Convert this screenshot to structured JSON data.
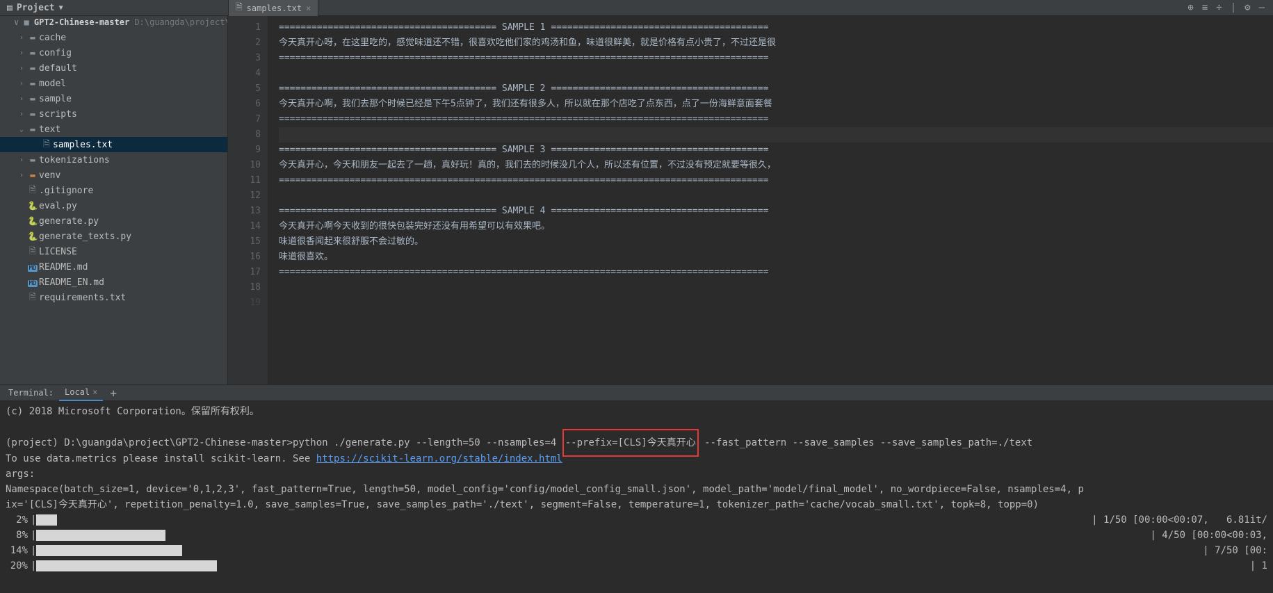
{
  "header": {
    "project_label": "Project",
    "open_file_tab": "samples.txt",
    "toolbar_icons": [
      "target-icon",
      "vertical-bars-icon",
      "horizontal-bars-icon",
      "gear-icon",
      "minimize-icon"
    ]
  },
  "breadcrumb": {
    "project_name": "GPT2-Chinese-master",
    "path_hint": "D:\\guangda\\project\\G"
  },
  "tree": [
    {
      "depth": 1,
      "arrow": ">",
      "icon": "folder",
      "label": "cache"
    },
    {
      "depth": 1,
      "arrow": ">",
      "icon": "folder",
      "label": "config"
    },
    {
      "depth": 1,
      "arrow": ">",
      "icon": "folder",
      "label": "default"
    },
    {
      "depth": 1,
      "arrow": ">",
      "icon": "folder",
      "label": "model"
    },
    {
      "depth": 1,
      "arrow": ">",
      "icon": "folder",
      "label": "sample"
    },
    {
      "depth": 1,
      "arrow": ">",
      "icon": "folder",
      "label": "scripts"
    },
    {
      "depth": 1,
      "arrow": "v",
      "icon": "folder",
      "label": "text"
    },
    {
      "depth": 2,
      "arrow": "",
      "icon": "txt",
      "label": "samples.txt",
      "selected": true
    },
    {
      "depth": 1,
      "arrow": ">",
      "icon": "folder",
      "label": "tokenizations"
    },
    {
      "depth": 1,
      "arrow": ">",
      "icon": "folder-orange",
      "label": "venv"
    },
    {
      "depth": 1,
      "arrow": "",
      "icon": "txt",
      "label": ".gitignore"
    },
    {
      "depth": 1,
      "arrow": "",
      "icon": "py",
      "label": "eval.py"
    },
    {
      "depth": 1,
      "arrow": "",
      "icon": "py",
      "label": "generate.py"
    },
    {
      "depth": 1,
      "arrow": "",
      "icon": "py",
      "label": "generate_texts.py"
    },
    {
      "depth": 1,
      "arrow": "",
      "icon": "txt",
      "label": "LICENSE"
    },
    {
      "depth": 1,
      "arrow": "",
      "icon": "md",
      "label": "README.md"
    },
    {
      "depth": 1,
      "arrow": "",
      "icon": "md",
      "label": "README_EN.md"
    },
    {
      "depth": 1,
      "arrow": "",
      "icon": "txt",
      "label": "requirements.txt"
    }
  ],
  "editor": {
    "lines": [
      "======================================== SAMPLE 1 ========================================",
      "今天真开心呀，在这里吃的，感觉味道还不错，很喜欢吃他们家的鸡汤和鱼，味道很鲜美，就是价格有点小贵了，不过还是很",
      "==========================================================================================",
      "",
      "======================================== SAMPLE 2 ========================================",
      "今天真开心啊，我们去那个时候已经是下午5点钟了，我们还有很多人，所以就在那个店吃了点东西，点了一份海鲜意面套餐",
      "==========================================================================================",
      "",
      "======================================== SAMPLE 3 ========================================",
      "今天真开心，今天和朋友一起去了一趟，真好玩！真的，我们去的时候没几个人，所以还有位置，不过没有预定就要等很久，",
      "==========================================================================================",
      "",
      "======================================== SAMPLE 4 ========================================",
      "今天真开心啊今天收到的很快包装完好还没有用希望可以有效果吧。",
      "味道很香闻起来很舒服不会过敏的。",
      "味道很喜欢。",
      "==========================================================================================",
      ""
    ],
    "current_line_index": 7
  },
  "terminal": {
    "tab_group_label": "Terminal:",
    "tab_label": "Local",
    "copyright_line": "(c) 2018 Microsoft Corporation。保留所有权利。",
    "prompt_prefix": "(project) D:\\guangda\\project\\GPT2-Chinese-master>",
    "command_before": "python ./generate.py --length=50 --nsamples=4 ",
    "command_boxed": "--prefix=[CLS]今天真开心",
    "command_after": " --fast_pattern --save_samples --save_samples_path=./text",
    "scikit_line_prefix": "To use data.metrics please install scikit-learn. See ",
    "scikit_link": "https://scikit-learn.org/stable/index.html",
    "args_label": "args:",
    "namespace_line1": "Namespace(batch_size=1, device='0,1,2,3', fast_pattern=True, length=50, model_config='config/model_config_small.json', model_path='model/final_model', no_wordpiece=False, nsamples=4, p",
    "namespace_line2": "ix='[CLS]今天真开心', repetition_penalty=1.0, save_samples=True, save_samples_path='./text', segment=False, temperature=1, tokenizer_path='cache/vocab_small.txt', topk=8, topp=0)",
    "progress": [
      {
        "pct": "2%",
        "fill": 30,
        "right": "| 1/50 [00:00<00:07,   6.81it/"
      },
      {
        "pct": "8%",
        "fill": 186,
        "right": "| 4/50 [00:00<00:03,"
      },
      {
        "pct": "14%",
        "fill": 210,
        "right": "| 7/50 [00:"
      },
      {
        "pct": "20%",
        "fill": 260,
        "right": "| 1"
      }
    ]
  }
}
